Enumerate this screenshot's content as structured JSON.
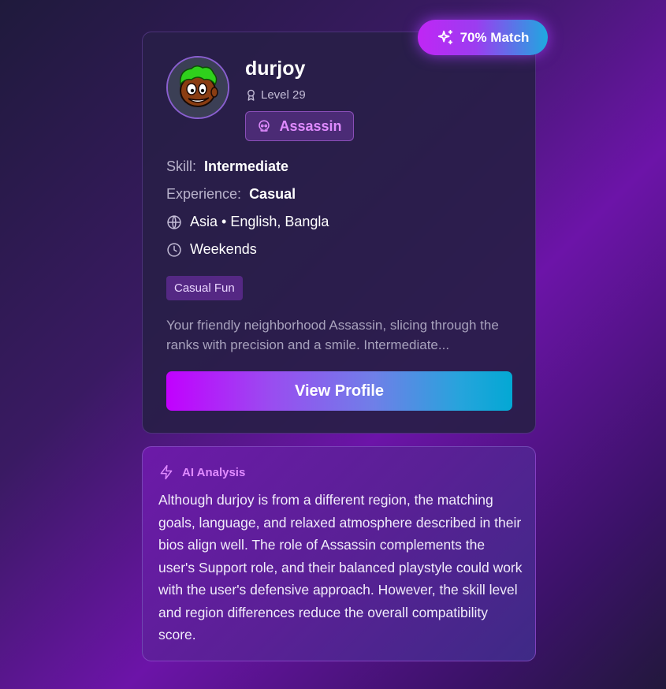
{
  "match": {
    "label": "70% Match",
    "icon": "sparkles-icon"
  },
  "profile": {
    "username": "durjoy",
    "level": "Level 29",
    "role": "Assassin",
    "skill_label": "Skill:",
    "skill_value": "Intermediate",
    "experience_label": "Experience:",
    "experience_value": "Casual",
    "region_languages": "Asia • English, Bangla",
    "availability": "Weekends",
    "tag": "Casual Fun",
    "bio": "Your friendly neighborhood Assassin, slicing through the ranks with precision and a smile. Intermediate...",
    "view_button": "View Profile"
  },
  "ai_analysis": {
    "title": "AI Analysis",
    "text": "Although durjoy is from a different region, the matching goals, language, and relaxed atmosphere described in their bios align well. The role of Assassin complements the user's Support role, and their balanced playstyle could work with the user's defensive approach. However, the skill level and region differences reduce the overall compatibility score."
  },
  "colors": {
    "accent_pink": "#e08bff",
    "accent_purple": "#c200ff",
    "accent_cyan": "#03a8d4",
    "card_bg": "#281e48"
  }
}
